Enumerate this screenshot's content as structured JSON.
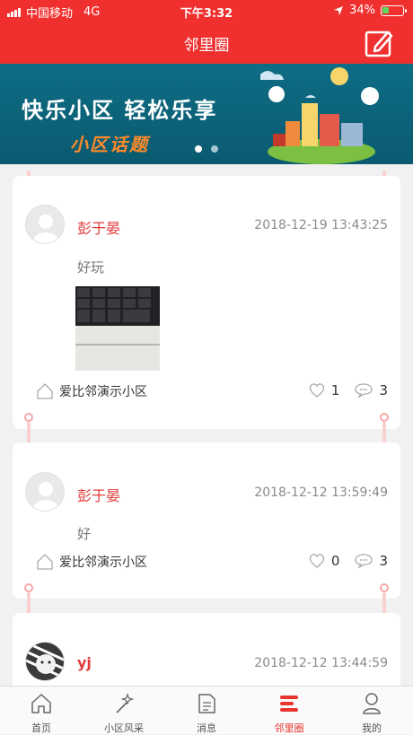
{
  "status_bar": {
    "carrier": "中国移动",
    "network": "4G",
    "time": "下午3:32",
    "battery": "34%"
  },
  "nav": {
    "title": "邻里圈",
    "edit_icon": "edit-icon"
  },
  "banner": {
    "main_text": "快乐小区  轻松乐享",
    "sub_text": "小区话题",
    "active_index": 0,
    "slide_count": 2
  },
  "posts": [
    {
      "author": "彭于晏",
      "time": "2018-12-19 13:43:25",
      "content": "好玩",
      "has_photo": true,
      "community": "爱比邻演示小区",
      "likes": "1",
      "comments": "3"
    },
    {
      "author": "彭于晏",
      "time": "2018-12-12 13:59:49",
      "content": "好",
      "has_photo": false,
      "community": "爱比邻演示小区",
      "likes": "0",
      "comments": "3"
    },
    {
      "author": "yj",
      "time": "2018-12-12 13:44:59"
    }
  ],
  "tabs": [
    {
      "label": "首页",
      "icon": "home-icon"
    },
    {
      "label": "小区风采",
      "icon": "magic-wand-icon"
    },
    {
      "label": "消息",
      "icon": "document-icon"
    },
    {
      "label": "邻里圈",
      "icon": "neighborhood-icon",
      "active": true
    },
    {
      "label": "我的",
      "icon": "user-icon"
    }
  ],
  "colors": {
    "brand": "#f0302f",
    "author": "#e23a3a",
    "banner_bg": "#0e6d84",
    "banner_accent": "#ff8a2a"
  }
}
